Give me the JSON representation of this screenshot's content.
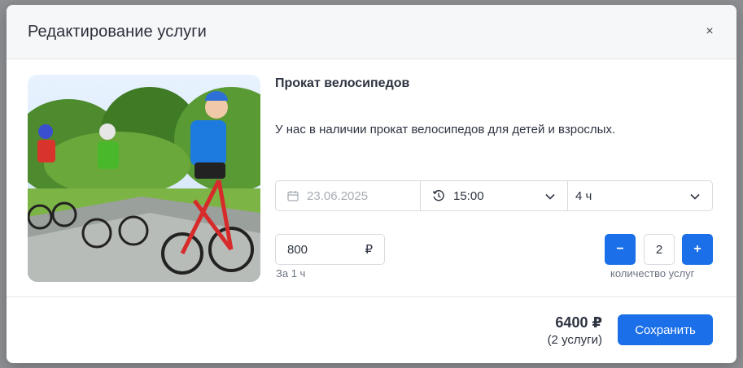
{
  "modal": {
    "title": "Редактирование услуги",
    "close_icon": "×"
  },
  "service": {
    "photo_icon": "cycling-kids-photo",
    "title": "Прокат велосипедов",
    "description": "У нас в наличии прокат велосипедов для детей и взрослых."
  },
  "booking": {
    "date": "23.06.2025",
    "time": "15:00",
    "duration": "4 ч"
  },
  "price": {
    "value": "800",
    "currency": "₽",
    "hint": "За 1 ч"
  },
  "quantity": {
    "minus": "−",
    "value": "2",
    "plus": "+",
    "label": "количество услуг"
  },
  "footer": {
    "total": "6400 ₽",
    "total_sub": "(2 услуги)",
    "save_label": "Сохранить"
  },
  "colors": {
    "accent": "#1b6fe8"
  }
}
